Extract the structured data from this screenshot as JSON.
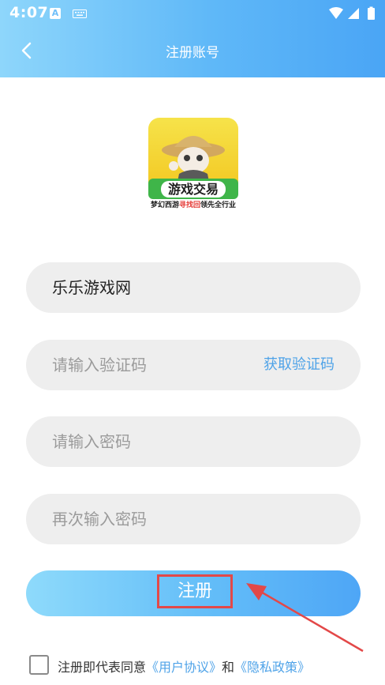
{
  "statusbar": {
    "time": "4:07",
    "icon_a": "A"
  },
  "header": {
    "title": "注册账号"
  },
  "logo": {
    "badge_text": "游戏交易",
    "slogan_part1": "梦幻西游",
    "slogan_part2": "寻找回",
    "slogan_part3": "领先全行业"
  },
  "form": {
    "account_value": "乐乐游戏网",
    "code_placeholder": "请输入验证码",
    "get_code_label": "获取验证码",
    "password_placeholder": "请输入密码",
    "confirm_password_placeholder": "再次输入密码"
  },
  "register_button": {
    "label": "注册"
  },
  "agreement": {
    "prefix": "注册即代表同意",
    "user_agreement": "《用户协议》",
    "conjunction": "和",
    "privacy_policy": "《隐私政策》"
  },
  "colors": {
    "accent": "#4fa3e8",
    "highlight_box": "#e34848",
    "field_bg": "#eeeeee"
  }
}
